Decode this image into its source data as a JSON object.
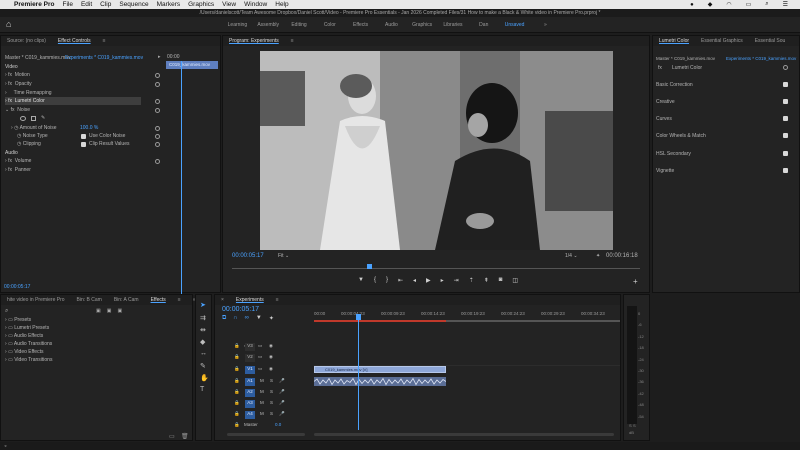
{
  "menubar": {
    "apple": "",
    "app_name": "Premiere Pro",
    "items": [
      "File",
      "Edit",
      "Clip",
      "Sequence",
      "Markers",
      "Graphics",
      "View",
      "Window",
      "Help"
    ]
  },
  "window_title": "/Users/danielscott/Team Awesome Dropbox/Daniel Scott/Video - Premiere Pro Essentials - Jan 2026 Completed Files/31 How to make a Black & White video in Premiere Pro.prproj *",
  "workspaces": {
    "tabs": [
      "Learning",
      "Assembly",
      "Editing",
      "Color",
      "Effects",
      "Audio",
      "Graphics",
      "Libraries",
      "Dan",
      "Unsaved",
      "»"
    ],
    "active": "Unsaved"
  },
  "source_panel": {
    "tabs": [
      "Source: (no clips)",
      "Effect Controls",
      "≡"
    ],
    "master_label": "Master * C019_kammies.mov",
    "sequence_label": "Experiments * C019_kammies.mov",
    "mini_timecode_start": "00:00",
    "mini_clip": "C019_kammies.mov",
    "video_header": "Video",
    "effects": [
      {
        "label": "Motion"
      },
      {
        "label": "Opacity"
      },
      {
        "label": "Time Remapping"
      },
      {
        "label": "Lumetri Color"
      },
      {
        "label": "Noise"
      }
    ],
    "amount_label": "Amount of Noise",
    "amount_value": "100.0 %",
    "noise_type_label": "Noise Type",
    "use_color_noise": "Use Color Noise",
    "clipping_label": "Clipping",
    "clip_result": "Clip Result Values",
    "audio_header": "Audio",
    "audio_items": [
      "Volume",
      "Panner"
    ],
    "timecode": "00:00:05:17"
  },
  "program": {
    "title": "Program: Experiments",
    "timecode": "00:00:05:17",
    "fit": "Fit",
    "resolution": "1/4",
    "duration": "00:00:16:18"
  },
  "lumetri": {
    "tabs": [
      "Lumetri Color",
      "Essential Graphics",
      "Essential Sou"
    ],
    "master_label": "Master * C019_kammies.mov",
    "sequence_label": "Experiments * C019_kammies.mov",
    "fx_label": "Lumetri Color",
    "sections": [
      "Basic Correction",
      "Creative",
      "Curves",
      "Color Wheels & Match",
      "HSL Secondary",
      "Vignette"
    ]
  },
  "project_panel": {
    "tabs": [
      "hite video in Premiere Pro",
      "Bin: B Cam",
      "Bin: A Cam",
      "Effects"
    ],
    "items": [
      "Presets",
      "Lumetri Presets",
      "Audio Effects",
      "Audio Transitions",
      "Video Effects",
      "Video Transitions"
    ]
  },
  "timeline": {
    "title": "Experiments",
    "timecode": "00:00:05:17",
    "ruler": [
      "00:00",
      "00:00:04:23",
      "00:00:09:23",
      "00:00:14:23",
      "00:00:19:23",
      "00:00:24:23",
      "00:00:29:23",
      "00:00:34:23"
    ],
    "video_tracks": [
      "V3",
      "V2",
      "V1"
    ],
    "audio_tracks": [
      "A1",
      "A2",
      "A3",
      "A4"
    ],
    "master_label": "Master",
    "master_value": "0.0",
    "video_clip": "C019_kammies.mov [V]"
  },
  "meter": {
    "scale": [
      "0",
      "-6",
      "-12",
      "-18",
      "-24",
      "-30",
      "-36",
      "-42",
      "-48",
      "-54"
    ],
    "db_label": "dB",
    "channels": [
      "S",
      "S"
    ]
  }
}
